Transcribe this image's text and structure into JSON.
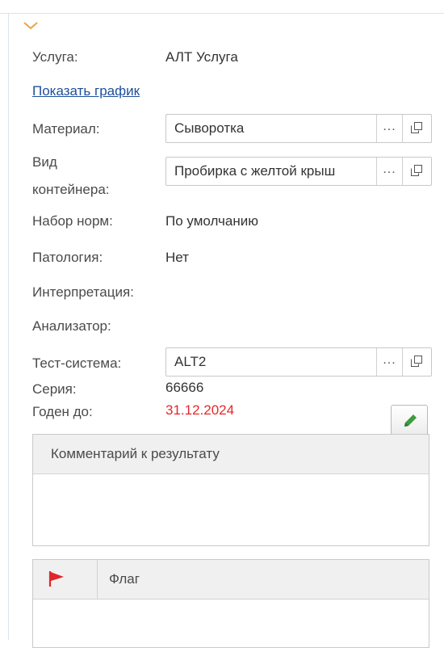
{
  "form": {
    "service_label": "Услуга:",
    "service_value": "АЛТ Услуга",
    "show_chart_link": "Показать график",
    "material_label": "Материал:",
    "material_value": "Сыворотка",
    "container_label_line1": "Вид",
    "container_label_line2": "контейнера:",
    "container_value": "Пробирка с желтой крыш",
    "norm_set_label": "Набор норм:",
    "norm_set_value": "По умолчанию",
    "pathology_label": "Патология:",
    "pathology_value": "Нет",
    "interpretation_label": "Интерпретация:",
    "analyzer_label": "Анализатор:",
    "test_system_label": "Тест-система:",
    "test_system_value": "ALT2",
    "series_label": "Серия:",
    "series_value": "66666",
    "valid_until_label": "Годен до:",
    "valid_until_value": "31.12.2024",
    "select_button_glyph": "..."
  },
  "comment_panel": {
    "header": "Комментарий к результату"
  },
  "flag_table": {
    "header": "Флаг"
  },
  "colors": {
    "link": "#1f4f99",
    "date_red": "#e8262a",
    "chevron": "#e8a54a",
    "flag_red": "#e0262d",
    "pencil_green": "#3f9b3f"
  }
}
